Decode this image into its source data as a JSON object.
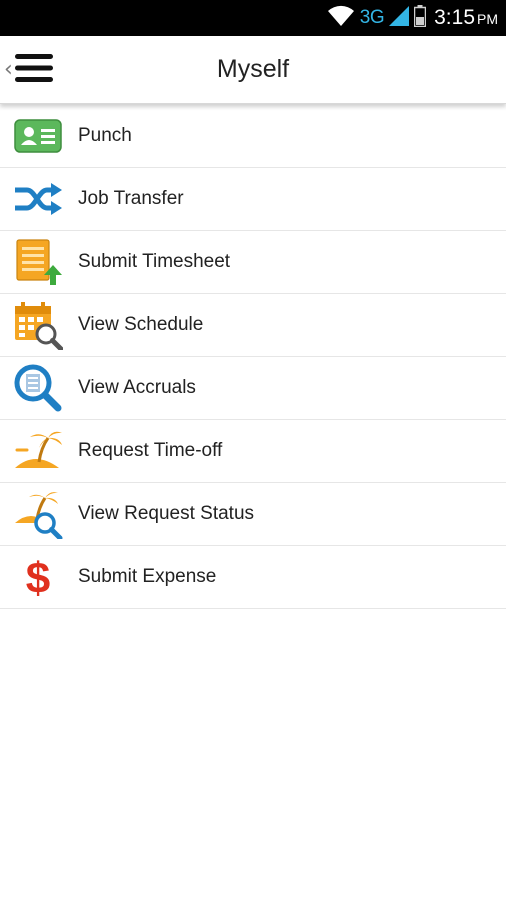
{
  "status_bar": {
    "network": "3G",
    "time": "3:15",
    "ampm": "PM"
  },
  "header": {
    "title": "Myself"
  },
  "menu": {
    "items": [
      {
        "label": "Punch",
        "icon": "punch-card-icon"
      },
      {
        "label": "Job Transfer",
        "icon": "shuffle-icon"
      },
      {
        "label": "Submit Timesheet",
        "icon": "timesheet-upload-icon"
      },
      {
        "label": "View Schedule",
        "icon": "calendar-search-icon"
      },
      {
        "label": "View Accruals",
        "icon": "magnifier-document-icon"
      },
      {
        "label": "Request Time-off",
        "icon": "palm-island-icon"
      },
      {
        "label": "View Request Status",
        "icon": "palm-island-search-icon"
      },
      {
        "label": "Submit Expense",
        "icon": "dollar-icon"
      }
    ]
  },
  "colors": {
    "status_bar_bg": "#000000",
    "network_accent": "#33b5e5",
    "green": "#5cb85c",
    "blue": "#1f7fc4",
    "orange": "#f5a623",
    "red": "#e0301e"
  }
}
